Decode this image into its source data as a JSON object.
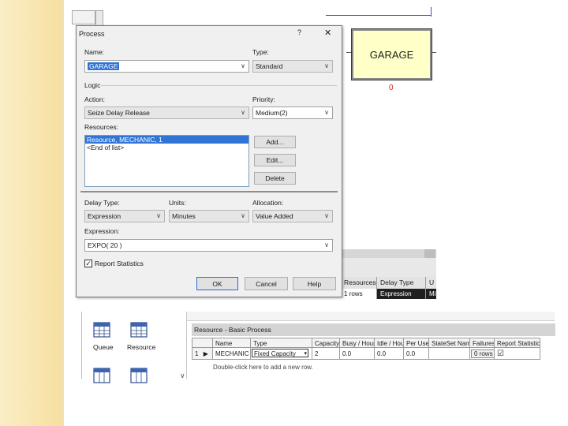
{
  "dialog": {
    "title": "Process",
    "help_glyph": "?",
    "close_glyph": "✕",
    "name_label": "Name:",
    "name_value": "GARAGE",
    "type_label": "Type:",
    "type_value": "Standard",
    "logic_label": "Logic",
    "action_label": "Action:",
    "action_value": "Seize Delay Release",
    "priority_label": "Priority:",
    "priority_value": "Medium(2)",
    "resources_label": "Resources:",
    "resources_list": [
      "Resource, MECHANIC, 1",
      "<End of list>"
    ],
    "add_button": "Add...",
    "edit_button": "Edit...",
    "delete_button": "Delete",
    "delay_type_label": "Delay Type:",
    "delay_type_value": "Expression",
    "units_label": "Units:",
    "units_value": "Minutes",
    "allocation_label": "Allocation:",
    "allocation_value": "Value Added",
    "expression_label": "Expression:",
    "expression_value": "EXPO( 20 )",
    "report_statistics_label": "Report Statistics",
    "report_statistics_checked": true,
    "ok_button": "OK",
    "cancel_button": "Cancel",
    "help_button": "Help"
  },
  "canvas": {
    "module_label": "GARAGE",
    "module_count": "0",
    "grid_headers": [
      "Resources",
      "Delay Type",
      "U"
    ],
    "grid_values": [
      "1 rows",
      "Expression",
      "Mi"
    ]
  },
  "project_bar": {
    "items": [
      {
        "label": "Queue",
        "icon": "table-icon"
      },
      {
        "label": "Resource",
        "icon": "table-icon"
      }
    ]
  },
  "spreadsheet": {
    "title": "Resource - Basic Process",
    "columns": [
      "",
      "Name",
      "Type",
      "Capacity",
      "Busy / Hour",
      "Idle / Hour",
      "Per Use",
      "StateSet Name",
      "Failures",
      "Report Statistics"
    ],
    "rows": [
      {
        "num": "1",
        "marker": "▶",
        "name": "MECHANIC",
        "type": "Fixed Capacity",
        "capacity": "2",
        "busy_hour": "0.0",
        "idle_hour": "0.0",
        "per_use": "0.0",
        "stateset": "",
        "failures": "0 rows",
        "report_statistics": "☑"
      }
    ],
    "add_row_hint": "Double-click here to add a new row."
  },
  "colors": {
    "accent_selection": "#3075d6",
    "module_fill": "#ffffc8",
    "connector": "#3a56c8",
    "counter": "#d9241c",
    "slide_strip": "#f6dfa0"
  }
}
